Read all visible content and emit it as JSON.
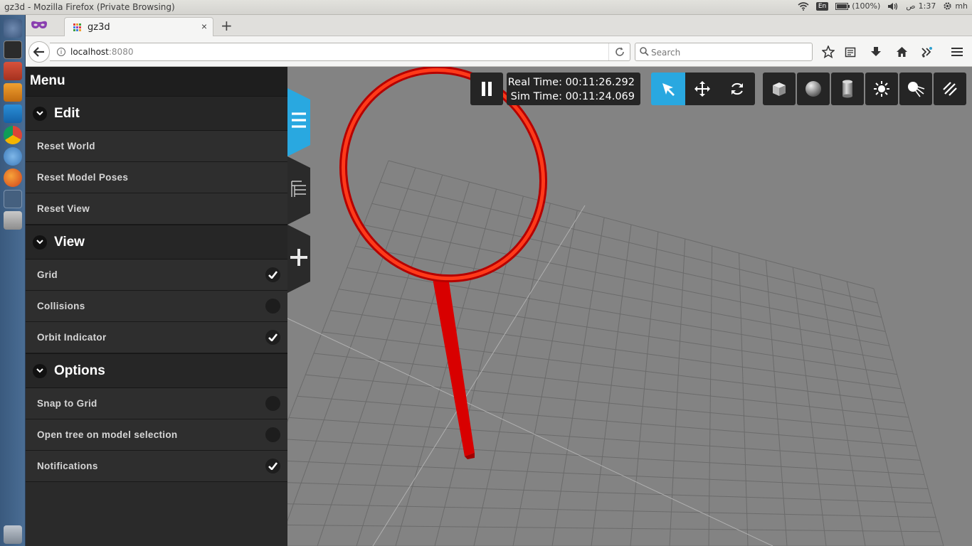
{
  "os": {
    "window_title": "gz3d - Mozilla Firefox (Private Browsing)",
    "lang": "En",
    "battery": "(100%)",
    "time_suffix": "ص",
    "time": "1:37",
    "user": "mh"
  },
  "browser": {
    "tab_title": "gz3d",
    "tab_close": "×",
    "new_tab": "+",
    "url_host": "localhost",
    "url_port": ":8080",
    "search_placeholder": "Search"
  },
  "menu": {
    "title": "Menu",
    "sections": [
      {
        "label": "Edit",
        "items": [
          {
            "label": "Reset World"
          },
          {
            "label": "Reset Model Poses"
          },
          {
            "label": "Reset View"
          }
        ]
      },
      {
        "label": "View",
        "items": [
          {
            "label": "Grid",
            "checked": true
          },
          {
            "label": "Collisions",
            "checked": false
          },
          {
            "label": "Orbit Indicator",
            "checked": true
          }
        ]
      },
      {
        "label": "Options",
        "items": [
          {
            "label": "Snap to Grid",
            "checked": false
          },
          {
            "label": "Open tree on model selection",
            "checked": false
          },
          {
            "label": "Notifications",
            "checked": true
          }
        ]
      }
    ]
  },
  "toolbar": {
    "real_time": "Real Time: 00:11:26.292",
    "sim_time": "Sim Time: 00:11:24.069",
    "active_tool": "select",
    "accent": "#29a8e0"
  },
  "colors": {
    "model": "#e00000",
    "menu_bg": "#2a2a2a",
    "viewport_bg": "#838383"
  }
}
